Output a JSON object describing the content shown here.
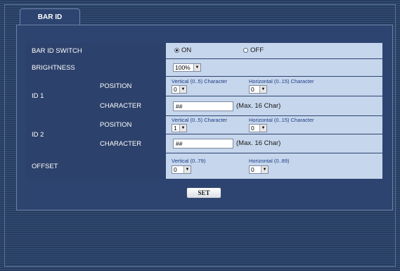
{
  "tab": {
    "label": "BAR ID"
  },
  "rows": {
    "bar_id_switch": {
      "label": "BAR ID SWITCH",
      "options": [
        "ON",
        "OFF"
      ],
      "selected": "ON"
    },
    "brightness": {
      "label": "BRIGHTNESS",
      "value": "100%"
    },
    "id1": {
      "label": "ID 1",
      "position": {
        "label": "POSITION",
        "vertical_label": "Vertical (0..5) Character",
        "vertical_value": "0",
        "horizontal_label": "Horizontal (0..15) Character",
        "horizontal_value": "0"
      },
      "character": {
        "label": "CHARACTER",
        "value": "##",
        "hint": "(Max. 16 Char)"
      }
    },
    "id2": {
      "label": "ID 2",
      "position": {
        "label": "POSITION",
        "vertical_label": "Vertical (0..5) Character",
        "vertical_value": "1",
        "horizontal_label": "Horizontal (0..15) Character",
        "horizontal_value": "0"
      },
      "character": {
        "label": "CHARACTER",
        "value": "##",
        "hint": "(Max. 16 Char)"
      }
    },
    "offset": {
      "label": "OFFSET",
      "vertical_label": "Vertical (0..79)",
      "vertical_value": "0",
      "horizontal_label": "Horizontal (0..89)",
      "horizontal_value": "0"
    }
  },
  "set_button": {
    "label": "SET"
  },
  "icons": {
    "dropdown": "dropdown-arrow-icon",
    "radio": "radio-button-icon"
  },
  "colors": {
    "background": "#2a4166",
    "label_cell": "#2c416b",
    "value_cell": "#c6d6ec",
    "note_text": "#1e3e86"
  }
}
